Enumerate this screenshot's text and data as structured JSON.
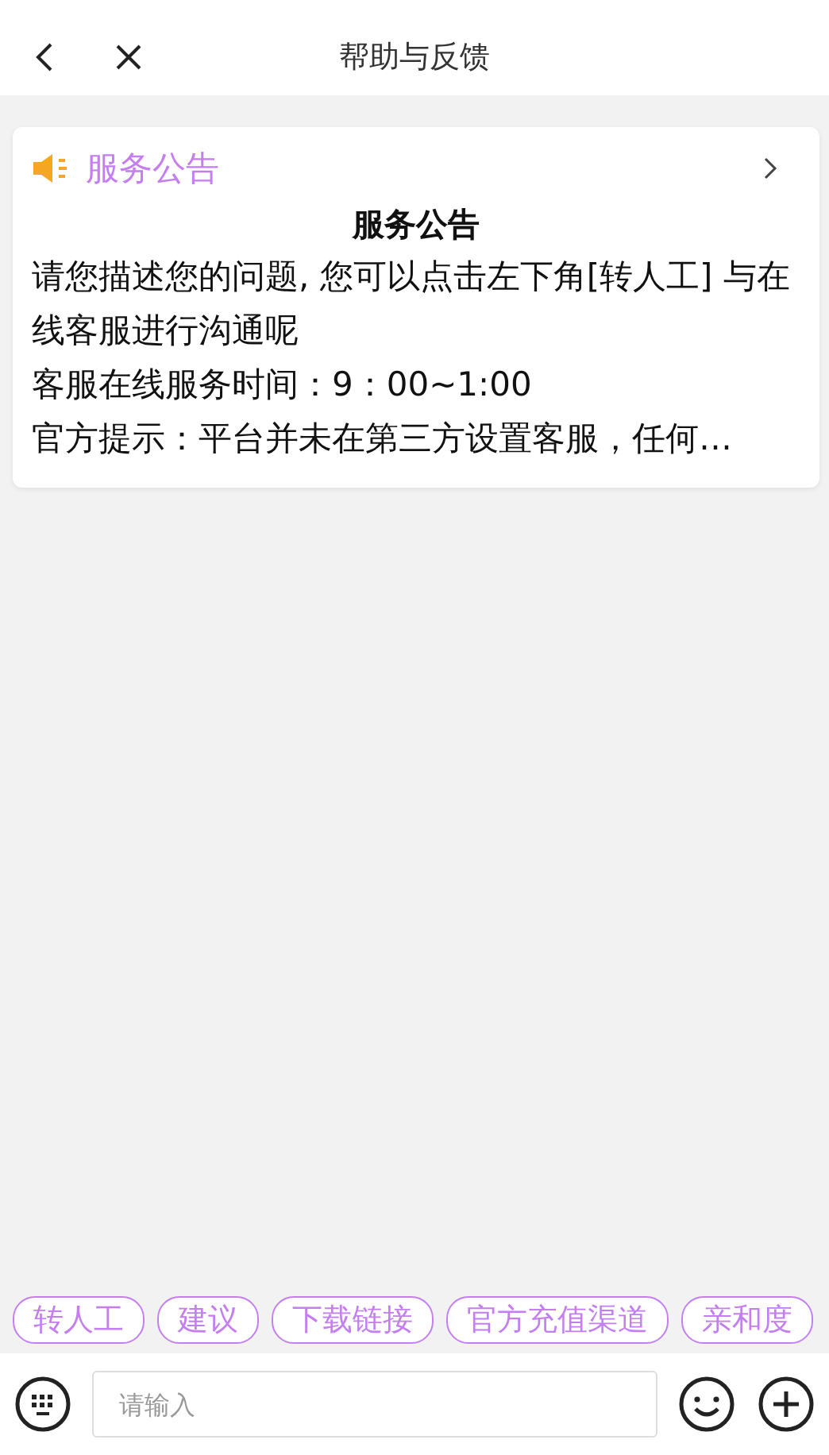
{
  "header": {
    "title": "帮助与反馈"
  },
  "notice": {
    "label": "服务公告",
    "title": "服务公告",
    "lines": [
      "请您描述您的问题, 您可以点击左下角[转人工] 与在线客服进行沟通呢",
      "客服在线服务时间：9：00~1:00",
      "官方提示：平台并未在第三方设置客服，任何…"
    ]
  },
  "quick_replies": [
    "转人工",
    "建议",
    "下载链接",
    "官方充值渠道",
    "亲和度"
  ],
  "input": {
    "placeholder": "请输入"
  }
}
